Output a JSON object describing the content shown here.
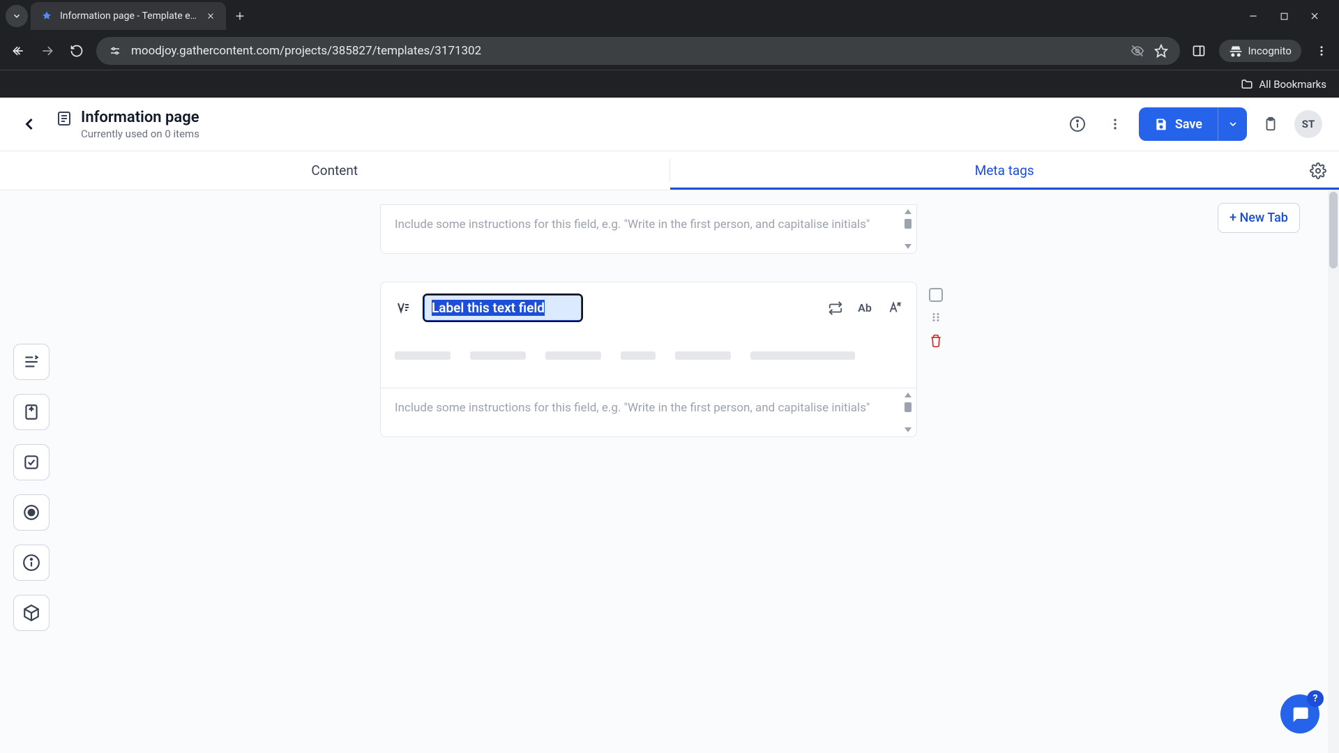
{
  "browser": {
    "tab_title": "Information page - Template e…",
    "url": "moodjoy.gathercontent.com/projects/385827/templates/3171302",
    "incognito_label": "Incognito",
    "all_bookmarks": "All Bookmarks"
  },
  "header": {
    "title": "Information page",
    "subtitle": "Currently used on 0 items",
    "save_label": "Save",
    "avatar_initials": "ST"
  },
  "tabs": {
    "content": "Content",
    "meta": "Meta tags"
  },
  "field": {
    "label_placeholder": "Label this text field",
    "instructions_placeholder": "Include some instructions for this field, e.g. \"Write in the first person, and capitalise initials\"",
    "ab_label": "Ab"
  },
  "right": {
    "new_tab": "+ New Tab"
  },
  "help": {
    "q": "?"
  }
}
